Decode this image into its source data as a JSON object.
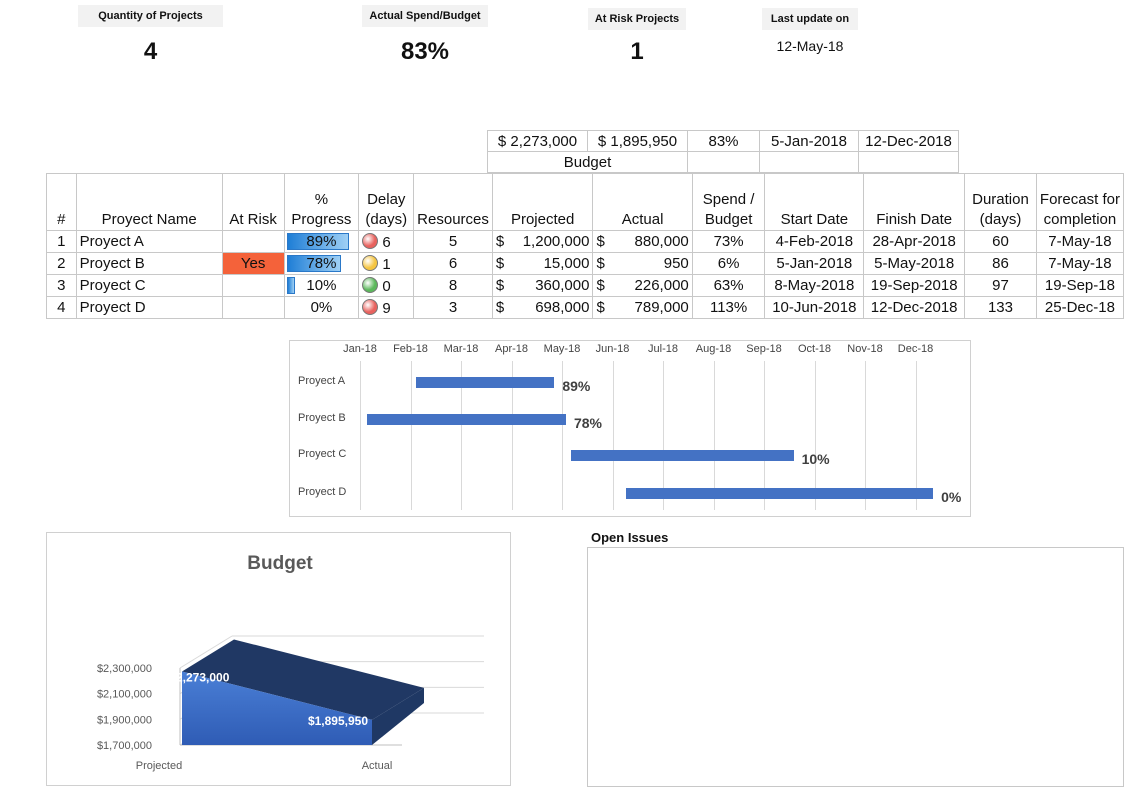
{
  "kpis": {
    "quantity_label": "Quantity of Projects",
    "quantity_value": "4",
    "spend_label": "Actual Spend/Budget",
    "spend_value": "83%",
    "risk_label": "At Risk Projects",
    "risk_value": "1",
    "update_label": "Last update on",
    "update_value": "12-May-18"
  },
  "summary": {
    "projected": "$ 2,273,000",
    "actual": "$ 1,895,950",
    "spend": "83%",
    "start": "5-Jan-2018",
    "finish": "12-Dec-2018",
    "budget_label": "Budget"
  },
  "table": {
    "headers": {
      "num": "#",
      "name": "Proyect Name",
      "risk": "At Risk",
      "progress_1": "%",
      "progress_2": "Progress",
      "delay_1": "Delay",
      "delay_2": "(days)",
      "resources": "Resources",
      "projected": "Projected",
      "actual": "Actual",
      "spend_1": "Spend /",
      "spend_2": "Budget",
      "start": "Start Date",
      "finish": "Finish Date",
      "duration_1": "Duration",
      "duration_2": "(days)",
      "forecast_1": "Forecast for",
      "forecast_2": "completion"
    },
    "rows": [
      {
        "num": "1",
        "name": "Proyect A",
        "risk": "",
        "progress": "89%",
        "progress_value": 0.89,
        "delay": "6",
        "delay_status": "red",
        "resources": "5",
        "projected": "1,200,000",
        "actual": "880,000",
        "spend": "73%",
        "start": "4-Feb-2018",
        "finish": "28-Apr-2018",
        "duration": "60",
        "forecast": "7-May-18"
      },
      {
        "num": "2",
        "name": "Proyect B",
        "risk": "Yes",
        "progress": "78%",
        "progress_value": 0.78,
        "delay": "1",
        "delay_status": "yellow",
        "resources": "6",
        "projected": "15,000",
        "actual": "950",
        "spend": "6%",
        "start": "5-Jan-2018",
        "finish": "5-May-2018",
        "duration": "86",
        "forecast": "7-May-18"
      },
      {
        "num": "3",
        "name": "Proyect C",
        "risk": "",
        "progress": "10%",
        "progress_value": 0.1,
        "delay": "0",
        "delay_status": "green",
        "resources": "8",
        "projected": "360,000",
        "actual": "226,000",
        "spend": "63%",
        "start": "8-May-2018",
        "finish": "19-Sep-2018",
        "duration": "97",
        "forecast": "19-Sep-18"
      },
      {
        "num": "4",
        "name": "Proyect D",
        "risk": "",
        "progress": "0%",
        "progress_value": 0,
        "delay": "9",
        "delay_status": "red",
        "resources": "3",
        "projected": "698,000",
        "actual": "789,000",
        "spend": "113%",
        "start": "10-Jun-2018",
        "finish": "12-Dec-2018",
        "duration": "133",
        "forecast": "25-Dec-18"
      }
    ],
    "currency": "$"
  },
  "status_colors": {
    "red": "#e8625e",
    "yellow": "#f5c542",
    "green": "#5cb85c",
    "risk": "#f4623a",
    "bar": "#4472c4"
  },
  "chart_data": [
    {
      "type": "bar",
      "title": "",
      "months": [
        "Jan-18",
        "Feb-18",
        "Mar-18",
        "Apr-18",
        "May-18",
        "Jun-18",
        "Jul-18",
        "Aug-18",
        "Sep-18",
        "Oct-18",
        "Nov-18",
        "Dec-18"
      ],
      "categories": [
        "Proyect A",
        "Proyect B",
        "Proyect C",
        "Proyect D"
      ],
      "start": [
        "2018-02-04",
        "2018-01-05",
        "2018-05-08",
        "2018-06-10"
      ],
      "finish": [
        "2018-04-28",
        "2018-05-05",
        "2018-09-19",
        "2018-12-12"
      ],
      "labels": [
        "89%",
        "78%",
        "10%",
        "0%"
      ]
    },
    {
      "type": "area",
      "title": "Budget",
      "categories": [
        "Projected",
        "Actual"
      ],
      "values": [
        2273000,
        1895950
      ],
      "data_labels": [
        "2,273,000",
        "$1,895,950"
      ],
      "ytick_labels": [
        "$2,300,000",
        "$2,100,000",
        "$1,900,000",
        "$1,700,000"
      ],
      "ylim": [
        1700000,
        2300000
      ]
    }
  ],
  "issues": {
    "title": "Open Issues"
  }
}
